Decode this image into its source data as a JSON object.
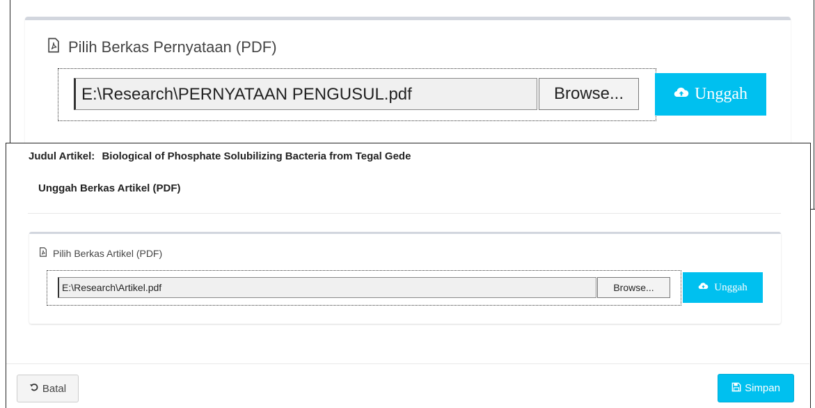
{
  "background_window": {
    "file_panel": {
      "heading": "Pilih Berkas Pernyataan (PDF)",
      "file_path": "E:\\Research\\PERNYATAAN PENGUSUL.pdf",
      "browse_label": "Browse...",
      "upload_label": "Unggah"
    }
  },
  "dialog": {
    "title_label": "Judul Artikel:",
    "title_value": "Biological of Phosphate Solubilizing Bacteria from Tegal Gede",
    "upload_heading": "Unggah Berkas Artikel (PDF)",
    "file_panel": {
      "heading": "Pilih Berkas Artikel (PDF)",
      "file_path": "E:\\Research\\Artikel.pdf",
      "browse_label": "Browse...",
      "upload_label": "Unggah"
    },
    "footer": {
      "cancel_label": "Batal",
      "save_label": "Simpan"
    }
  },
  "colors": {
    "accent": "#00c0ef",
    "panel_border": "#d2d6de"
  },
  "icons": [
    "pdf-file-icon",
    "cloud-upload-icon",
    "undo-icon",
    "save-icon"
  ]
}
